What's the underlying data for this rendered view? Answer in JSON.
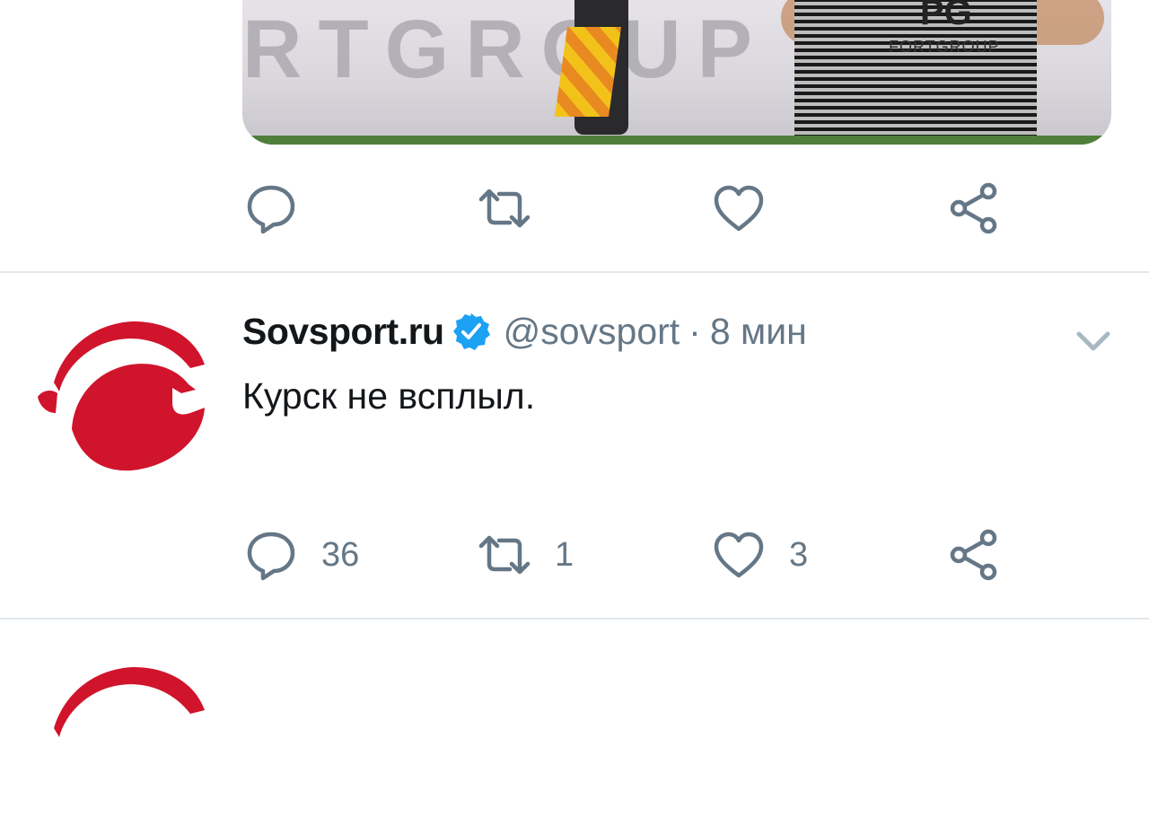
{
  "colors": {
    "brand_red": "#d0142c",
    "icon_gray": "#657786",
    "verified_blue": "#1da1f2",
    "divider": "#e1e8ed"
  },
  "media": {
    "banner_text": "RTGROUP",
    "shirt_logo": "PG",
    "sponsor": "FORTGROUP"
  },
  "prev_actions": {
    "reply_icon": "reply-icon",
    "retweet_icon": "retweet-icon",
    "like_icon": "heart-icon",
    "share_icon": "share-icon"
  },
  "tweet": {
    "author_name": "Sovsport.ru",
    "handle": "@sovsport",
    "separator": "·",
    "time": "8 мин",
    "text": "Курск не всплыл.",
    "replies": "36",
    "retweets": "1",
    "likes": "3"
  }
}
